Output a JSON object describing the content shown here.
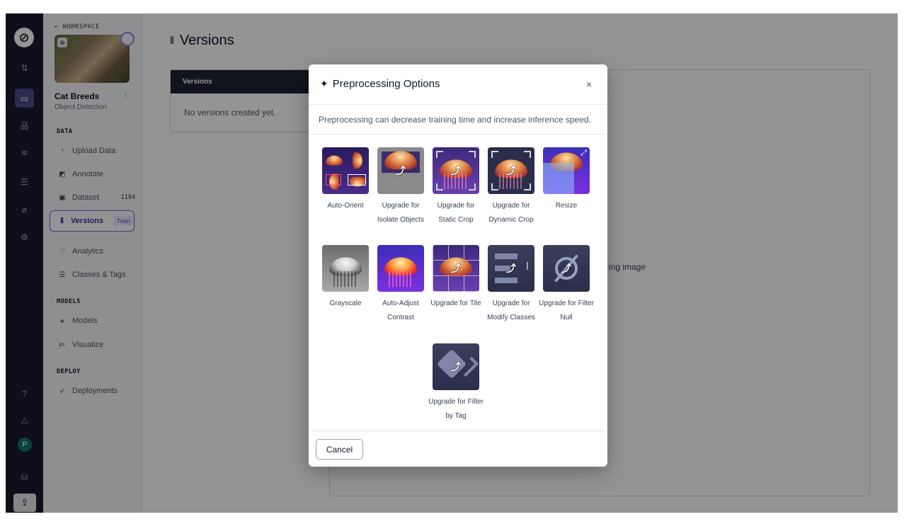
{
  "rail": {
    "logo": "logo-icon",
    "items": [
      "swap-icon",
      "image-icon",
      "hierarchy-icon",
      "chart-icon",
      "stack-icon",
      "pen-icon",
      "settings-icon"
    ],
    "bottom_items": [
      "help-icon",
      "bell-icon",
      "avatar",
      "database-icon",
      "upload-icon"
    ],
    "avatar_initial": "P"
  },
  "sidebar": {
    "back_label": "← WORKSPACE",
    "project_name": "Cat Breeds",
    "project_type": "Object Detection",
    "sections": {
      "data": "DATA",
      "models": "MODELS",
      "deploy": "DEPLOY"
    },
    "items": {
      "upload": {
        "label": "Upload Data",
        "icon": "↑"
      },
      "annotate": {
        "label": "Annotate",
        "icon": "◩"
      },
      "dataset": {
        "label": "Dataset",
        "icon": "▣",
        "count": "1194"
      },
      "versions": {
        "label": "Versions",
        "icon": "⫴",
        "badge": "Train"
      },
      "analytics": {
        "label": "Analytics",
        "icon": "♡"
      },
      "classes": {
        "label": "Classes & Tags",
        "icon": "☰"
      },
      "models": {
        "label": "Models",
        "icon": "⚹"
      },
      "visualize": {
        "label": "Visualize",
        "icon": "⊨"
      },
      "deployments": {
        "label": "Deployments",
        "icon": "➶"
      }
    }
  },
  "main": {
    "title": "Versions",
    "title_icon": "⫴",
    "versions_table": {
      "header": "Versions",
      "empty_text": "No versions created yet."
    },
    "panel_text": "ing image"
  },
  "modal": {
    "title": "Preprocessing Options",
    "title_icon": "✦",
    "close_icon": "×",
    "description": "Preprocessing can decrease training time and increase inference speed.",
    "options": [
      {
        "label": "Auto-Orient",
        "upgrade": false
      },
      {
        "label": "Upgrade for Isolate Objects",
        "upgrade": true
      },
      {
        "label": "Upgrade for Static Crop",
        "upgrade": true
      },
      {
        "label": "Upgrade for Dynamic Crop",
        "upgrade": true
      },
      {
        "label": "Resize",
        "upgrade": false
      },
      {
        "label": "Grayscale",
        "upgrade": false
      },
      {
        "label": "Auto-Adjust Contrast",
        "upgrade": false
      },
      {
        "label": "Upgrade for Tile",
        "upgrade": true
      },
      {
        "label": "Upgrade for Modify Classes",
        "upgrade": true
      },
      {
        "label": "Upgrade for Filter Null",
        "upgrade": true
      },
      {
        "label": "Upgrade for Filter by Tag",
        "upgrade": true
      }
    ],
    "upgrade_icon": "⤴",
    "cancel_label": "Cancel"
  },
  "colors": {
    "accent": "#6d5fe0",
    "rail_bg": "#191a2e",
    "table_header_bg": "#1f2433"
  }
}
